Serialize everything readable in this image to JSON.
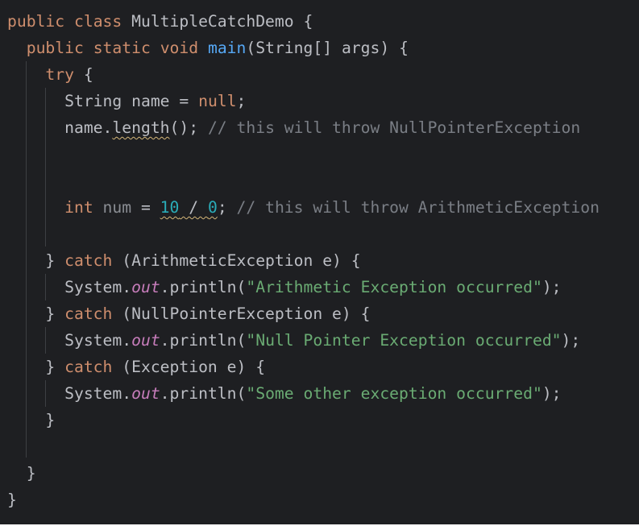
{
  "editor": {
    "class_name": "MultipleCatchDemo",
    "method_name": "main",
    "param_type": "String[]",
    "param_name": "args",
    "local_string_type": "String",
    "local_string_name": "name",
    "null_literal": "null",
    "call_receiver": "name",
    "call_method": "length",
    "comment_npe": "// this will throw NullPointerException",
    "int_keyword": "int",
    "int_var_name": "num",
    "numerator": "10",
    "denominator": "0",
    "comment_arith": "// this will throw ArithmeticException",
    "catch_types": [
      "ArithmeticException",
      "NullPointerException",
      "Exception"
    ],
    "catch_var": "e",
    "system_class": "System",
    "out_field": "out",
    "println_method": "println",
    "messages": [
      "\"Arithmetic Exception occurred\"",
      "\"Null Pointer Exception occurred\"",
      "\"Some other exception occurred\""
    ],
    "keywords": {
      "public": "public",
      "class": "class",
      "static": "static",
      "void": "void",
      "try": "try",
      "catch": "catch"
    }
  },
  "colors": {
    "background": "#1e1f22",
    "default_text": "#bcbec4",
    "keyword": "#cf8e6d",
    "method_declaration": "#56a8f5",
    "comment": "#7a7e85",
    "string": "#6aab73",
    "number": "#2aacb8",
    "static_field": "#c77dbb",
    "warning_underline": "#d5b778"
  }
}
